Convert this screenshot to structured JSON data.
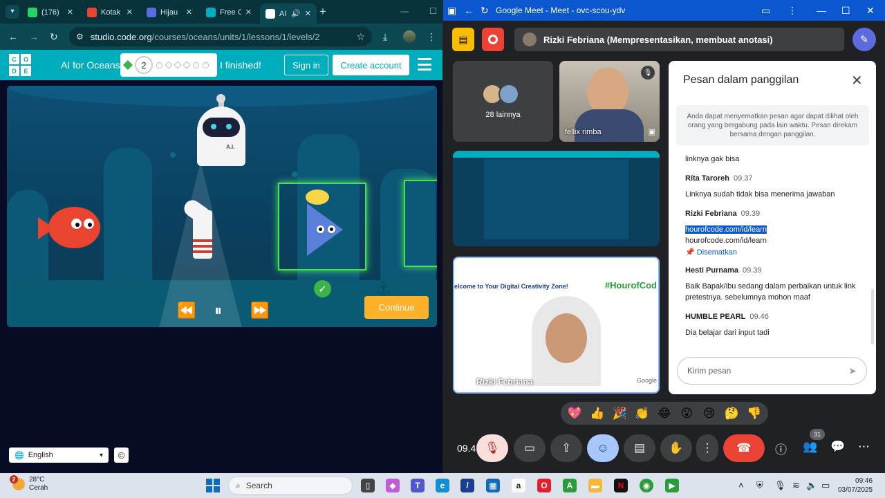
{
  "browser": {
    "tabs": [
      {
        "label": "(176)",
        "color": "#25d366"
      },
      {
        "label": "Kotak",
        "color": "#ea4335"
      },
      {
        "label": "Hijau",
        "color": "#5b6bde"
      },
      {
        "label": "Free C",
        "color": "#00adbc"
      },
      {
        "label": "AI",
        "color": "#333333"
      }
    ],
    "url_host": "studio.code.org",
    "url_path": "/courses/oceans/units/1/lessons/1/levels/2"
  },
  "codeorg": {
    "logo_letters": [
      "C",
      "O",
      "D",
      "E"
    ],
    "course_title": "AI for Oceans",
    "current_level": "2",
    "finished_label": "I finished!",
    "sign_in_label": "Sign in",
    "create_account_label": "Create account",
    "robot_label": "A.I.",
    "continue_label": "Continue",
    "language": "English",
    "copyright_symbol": "©"
  },
  "meet": {
    "window_title": "Google Meet - Meet - ovc-scou-ydv",
    "presenter_text": "Rizki Febriana (Mempresentasikan, membuat anotasi)",
    "tile_others_label": "28 lainnya",
    "tile_fellix_label": "fellix rimba",
    "tile_rizki_label": "Rizki Febriana",
    "rizki_slide_text_left": "elcome to Your Digital Creativity Zone!",
    "rizki_slide_text_right": "#HourofCod",
    "rizki_slide_brand": "Google",
    "chat": {
      "title": "Pesan dalam panggilan",
      "info": "Anda dapat menyematkan pesan agar dapat dilihat oleh orang yang bergabung pada lain waktu. Pesan direkam bersama dengan panggilan.",
      "first_line": "linknya gak bisa",
      "messages": [
        {
          "author": "Rita Taroreh",
          "time": "09.37",
          "text": "Linknya sudah tidak bisa menerima jawaban"
        },
        {
          "author": "Rizki Febriana",
          "time": "09.39",
          "highlight": "hourofcode.com/id/learn",
          "text": "hourofcode.com/id/learn",
          "pinned": "Disematkan"
        },
        {
          "author": "Hesti Purnama",
          "time": "09.39",
          "text": "Baik Bapak/ibu sedang dalam perbaikan untuk link pretestnya. sebelumnya mohon maaf"
        },
        {
          "author": "HUMBLE PEARL",
          "time": "09.46",
          "text": "Dia belajar dari input tadi"
        }
      ],
      "input_placeholder": "Kirim pesan"
    },
    "reactions": [
      "💖",
      "👍",
      "🎉",
      "👏",
      "😂",
      "😮",
      "😢",
      "🤔",
      "👎"
    ],
    "clock": "09.4",
    "people_count": "31"
  },
  "taskbar": {
    "badge": "2",
    "temperature": "28°C",
    "weather": "Cerah",
    "search_label": "Search",
    "time": "09:46",
    "date": "03/07/2025"
  }
}
